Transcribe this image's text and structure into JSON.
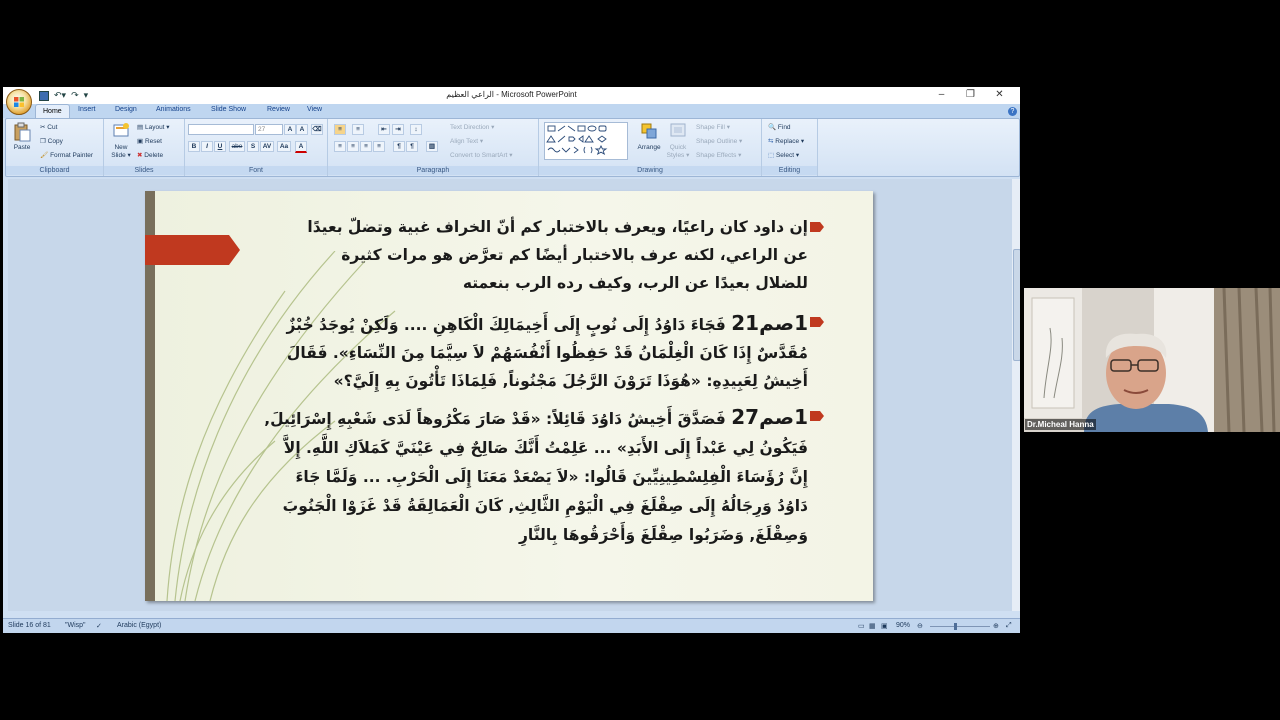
{
  "window": {
    "title": "الراعي العظيم - Microsoft PowerPoint",
    "controls": [
      "–",
      "❐",
      "✕"
    ]
  },
  "ribbon_tabs": [
    "Home",
    "Insert",
    "Design",
    "Animations",
    "Slide Show",
    "Review",
    "View"
  ],
  "ribbon": {
    "clipboard": {
      "label": "Clipboard",
      "paste": "Paste",
      "cut": "Cut",
      "copy": "Copy",
      "format_painter": "Format Painter"
    },
    "slides": {
      "label": "Slides",
      "new_slide_1": "New",
      "new_slide_2": "Slide ▾",
      "layout": "Layout ▾",
      "reset": "Reset",
      "delete": "Delete"
    },
    "font": {
      "label": "Font",
      "size": "27",
      "bold": "B",
      "italic": "I",
      "underline": "U",
      "strike": "abe",
      "shadow": "S",
      "spacing": "AV",
      "case": "Aa",
      "color": "A"
    },
    "paragraph": {
      "label": "Paragraph",
      "text_direction": "Text Direction ▾",
      "align_text": "Align Text ▾",
      "convert_smartart": "Convert to SmartArt ▾"
    },
    "drawing": {
      "label": "Drawing",
      "arrange": "Arrange",
      "quick_styles_1": "Quick",
      "quick_styles_2": "Styles ▾",
      "shape_fill": "Shape Fill ▾",
      "shape_outline": "Shape Outline ▾",
      "shape_effects": "Shape Effects ▾"
    },
    "editing": {
      "label": "Editing",
      "find": "Find",
      "replace": "Replace ▾",
      "select": "Select ▾"
    }
  },
  "slide": {
    "para1_lines": [
      "إن داود كان راعيًا، ويعرف بالاختبار كم أنّ الخراف غبية وتضلّ بعيدًا",
      "عن الراعي، لكنه عرف بالاختبار أيضًا كم تعرَّض هو مرات كثيرة",
      "للضلال بعيدًا عن الرب، وكيف رده الرب بنعمته"
    ],
    "para2_ref": "1صم21",
    "para2_lines": [
      "فَجَاءَ دَاوُدُ إِلَى نُوبٍ إِلَى أَخِيمَالِكَ الْكَاهِنِ .... وَلَكِنْ يُوجَدُ خُبْزٌ",
      "مُقَدَّسٌ إِذَا كَانَ الْغِلْمَانُ قَدْ حَفِظُوا أَنْفُسَهُمْ لاَ سِيَّمَا مِنَ النِّسَاءِ». فَقَالَ",
      "أَخِيشُ لِعَبِيدِهِ: «هُوَذَا تَرَوْنَ الرَّجُلَ مَجْنُوناً, فَلِمَاذَا تَأْتُونَ بِهِ إِلَيَّ؟»"
    ],
    "para3_ref": "1صم27",
    "para3_lines": [
      "فَصَدَّقَ أَخِيشُ دَاوُدَ قَائِلاً: «قَدْ صَارَ مَكْرُوهاً لَدَى شَعْبِهِ إِسْرَائِيلَ,",
      "فَيَكُونُ لِي عَبْداً إِلَى الأَبَدِ» ... عَلِمْتُ أَنَّكَ صَالِحٌ فِي عَيْنَيَّ كَمَلاَكِ اللَّهِ. إِلاَّ",
      "إِنَّ رُؤَسَاءَ الْفِلِسْطِينِيِّينَ قَالُوا: «لاَ يَصْعَدْ مَعَنَا إِلَى الْحَرْبِ. ... وَلَمَّا جَاءَ",
      "دَاوُدُ وَرِجَالُهُ إِلَى صِقْلَغَ فِي الْيَوْمِ الثَّالِثِ, كَانَ الْعَمَالِقَةُ قَدْ غَزَوْا الْجَنُوبَ",
      "وَصِقْلَغَ, وَضَرَبُوا صِقْلَغَ وَأَحْرَقُوهَا بِالنَّارِ"
    ]
  },
  "statusbar": {
    "slide_info": "Slide 16 of 81",
    "theme": "\"Wisp\"",
    "language": "Arabic (Egypt)",
    "zoom": "90%"
  },
  "webcam": {
    "name": "Dr.Micheal Hanna"
  },
  "colors": {
    "accent_red": "#c0391f",
    "bullet": "#c0391f"
  }
}
